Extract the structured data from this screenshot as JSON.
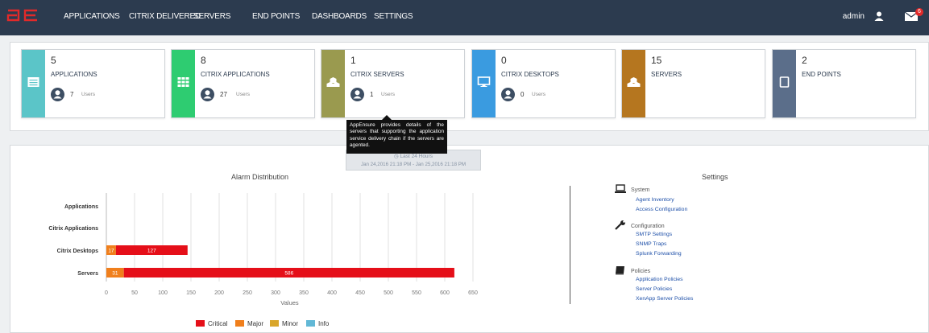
{
  "nav": {
    "items": [
      "APPLICATIONS",
      "CITRIX DELIVERED",
      "SERVERS",
      "END POINTS",
      "DASHBOARDS",
      "SETTINGS"
    ],
    "user": "admin",
    "mail_badge": "6"
  },
  "tiles": [
    {
      "count": "5",
      "title": "APPLICATIONS",
      "users": "7",
      "users_label": "Users",
      "color": "#5bc5c8",
      "icon": "list-icon"
    },
    {
      "count": "8",
      "title": "CITRIX APPLICATIONS",
      "users": "27",
      "users_label": "Users",
      "color": "#2ecc71",
      "icon": "grid-icon"
    },
    {
      "count": "1",
      "title": "CITRIX SERVERS",
      "users": "1",
      "users_label": "Users",
      "color": "#9a9a4f",
      "icon": "cubes-icon"
    },
    {
      "count": "0",
      "title": "CITRIX DESKTOPS",
      "users": "0",
      "users_label": "Users",
      "color": "#3a9be0",
      "icon": "monitor-icon"
    },
    {
      "count": "15",
      "title": "SERVERS",
      "users": "",
      "users_label": "",
      "color": "#b5761f",
      "icon": "cubes-icon"
    },
    {
      "count": "2",
      "title": "END POINTS",
      "users": "",
      "users_label": "",
      "color": "#5b6e8a",
      "icon": "tablet-icon"
    }
  ],
  "tooltip": "AppEnsure provides details of the servers that supporting the application service delivery chain if the servers are agented.",
  "time_range": {
    "label": "Last 24 Hours",
    "range": "Jan 24,2016 21:18 PM - Jan 25,2016 21:18 PM"
  },
  "chart_data": {
    "type": "bar",
    "orientation": "horizontal",
    "stacked": true,
    "title": "Alarm Distribution",
    "xlabel": "Values",
    "ylabel": "",
    "categories": [
      "Applications",
      "Citrix Applications",
      "Citrix Desktops",
      "Servers"
    ],
    "xlim": [
      0,
      650
    ],
    "xticks": [
      0,
      50,
      100,
      150,
      200,
      250,
      300,
      350,
      400,
      450,
      500,
      550,
      600,
      650
    ],
    "grid": true,
    "series": [
      {
        "name": "Major",
        "color": "#f07f1c",
        "values": [
          0,
          0,
          17,
          31
        ]
      },
      {
        "name": "Critical",
        "color": "#e50f19",
        "values": [
          0,
          0,
          127,
          586
        ]
      },
      {
        "name": "Minor",
        "color": "#d9a62b",
        "values": [
          0,
          0,
          0,
          0
        ]
      },
      {
        "name": "Info",
        "color": "#62b8d6",
        "values": [
          0,
          0,
          0,
          0
        ]
      }
    ],
    "legend": [
      "Critical",
      "Major",
      "Minor",
      "Info"
    ],
    "legend_position": "bottom"
  },
  "settings": {
    "title": "Settings",
    "groups": [
      {
        "label": "System",
        "icon": "laptop-icon",
        "links": [
          "Agent Inventory",
          "Access Configuration"
        ]
      },
      {
        "label": "Configuration",
        "icon": "wrench-icon",
        "links": [
          "SMTP Settings",
          "SNMP Traps",
          "Splunk Forwarding"
        ]
      },
      {
        "label": "Policies",
        "icon": "book-icon",
        "links": [
          "Application Policies",
          "Server Policies",
          "XenApp Server Policies"
        ]
      }
    ]
  }
}
